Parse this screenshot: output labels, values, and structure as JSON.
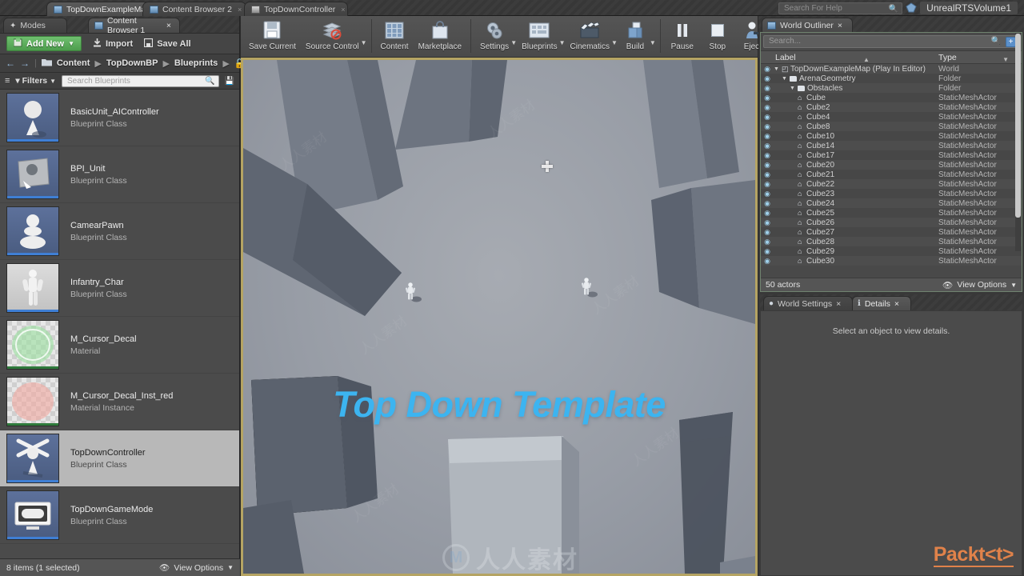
{
  "app": {
    "top_tabs": [
      {
        "label": "TopDownExampleMap",
        "icon": "map-icon",
        "active": true,
        "closable": true
      },
      {
        "label": "Content Browser 2",
        "icon": "content-browser-icon",
        "active": false,
        "closable": true
      },
      {
        "label": "TopDownController",
        "icon": "blueprint-icon",
        "active": false,
        "closable": true
      }
    ],
    "search_help_placeholder": "Search For Help",
    "volume_label": "UnrealRTSVolume1"
  },
  "left_panel": {
    "sub_tabs": [
      {
        "label": "Modes",
        "icon": "modes-icon",
        "active": false
      },
      {
        "label": "Content Browser 1",
        "icon": "content-browser-icon",
        "active": true
      }
    ],
    "toolbar": {
      "add_new": "Add New",
      "import": "Import",
      "save_all": "Save All"
    },
    "breadcrumb": [
      "Content",
      "TopDownBP",
      "Blueprints"
    ],
    "filters_label": "Filters",
    "search_placeholder": "Search Blueprints",
    "assets": [
      {
        "name": "BasicUnit_AIController",
        "type": "Blueprint Class",
        "thumb": "blueprint",
        "selected": false
      },
      {
        "name": "BPI_Unit",
        "type": "Blueprint Class",
        "thumb": "blueprint-interface",
        "selected": false
      },
      {
        "name": "CamearPawn",
        "type": "Blueprint Class",
        "thumb": "pawn",
        "selected": false
      },
      {
        "name": "Infantry_Char",
        "type": "Blueprint Class",
        "thumb": "character",
        "selected": false
      },
      {
        "name": "M_Cursor_Decal",
        "type": "Material",
        "thumb": "material-green",
        "selected": false
      },
      {
        "name": "M_Cursor_Decal_Inst_red",
        "type": "Material Instance",
        "thumb": "material-red",
        "selected": false
      },
      {
        "name": "TopDownController",
        "type": "Blueprint Class",
        "thumb": "controller",
        "selected": true
      },
      {
        "name": "TopDownGameMode",
        "type": "Blueprint Class",
        "thumb": "gamemode",
        "selected": false
      }
    ],
    "status": "8 items (1 selected)",
    "view_options": "View Options"
  },
  "main_toolbar": {
    "groups": [
      [
        {
          "label": "Save Current",
          "icon": "save-icon",
          "dropdown": false
        },
        {
          "label": "Source Control",
          "icon": "source-control-icon",
          "dropdown": true
        }
      ],
      [
        {
          "label": "Content",
          "icon": "content-icon",
          "dropdown": false
        },
        {
          "label": "Marketplace",
          "icon": "marketplace-icon",
          "dropdown": false
        }
      ],
      [
        {
          "label": "Settings",
          "icon": "settings-icon",
          "dropdown": true
        },
        {
          "label": "Blueprints",
          "icon": "blueprints-icon",
          "dropdown": true
        },
        {
          "label": "Cinematics",
          "icon": "cinematics-icon",
          "dropdown": true
        },
        {
          "label": "Build",
          "icon": "build-icon",
          "dropdown": true
        }
      ],
      [
        {
          "label": "Pause",
          "icon": "pause-icon",
          "dropdown": false
        },
        {
          "label": "Stop",
          "icon": "stop-icon",
          "dropdown": false
        },
        {
          "label": "Eject",
          "icon": "eject-icon",
          "dropdown": false
        }
      ]
    ]
  },
  "viewport": {
    "title_text": "Top Down Template",
    "title_color": "#3cb4f0",
    "border_color": "#b5a463",
    "cursor": "crosshair-cursor"
  },
  "world_outliner": {
    "tab_label": "World Outliner",
    "search_placeholder": "Search...",
    "columns": {
      "label": "Label",
      "type": "Type"
    },
    "rows": [
      {
        "label": "TopDownExampleMap (Play In Editor)",
        "type": "World",
        "depth": 0,
        "icon": "world-icon",
        "expandable": true
      },
      {
        "label": "ArenaGeometry",
        "type": "Folder",
        "depth": 1,
        "icon": "folder-icon",
        "expandable": true
      },
      {
        "label": "Obstacles",
        "type": "Folder",
        "depth": 2,
        "icon": "folder-icon",
        "expandable": true
      },
      {
        "label": "Cube",
        "type": "StaticMeshActor",
        "depth": 3,
        "icon": "mesh-icon",
        "expandable": false
      },
      {
        "label": "Cube2",
        "type": "StaticMeshActor",
        "depth": 3,
        "icon": "mesh-icon",
        "expandable": false
      },
      {
        "label": "Cube4",
        "type": "StaticMeshActor",
        "depth": 3,
        "icon": "mesh-icon",
        "expandable": false
      },
      {
        "label": "Cube8",
        "type": "StaticMeshActor",
        "depth": 3,
        "icon": "mesh-icon",
        "expandable": false
      },
      {
        "label": "Cube10",
        "type": "StaticMeshActor",
        "depth": 3,
        "icon": "mesh-icon",
        "expandable": false
      },
      {
        "label": "Cube14",
        "type": "StaticMeshActor",
        "depth": 3,
        "icon": "mesh-icon",
        "expandable": false
      },
      {
        "label": "Cube17",
        "type": "StaticMeshActor",
        "depth": 3,
        "icon": "mesh-icon",
        "expandable": false
      },
      {
        "label": "Cube20",
        "type": "StaticMeshActor",
        "depth": 3,
        "icon": "mesh-icon",
        "expandable": false
      },
      {
        "label": "Cube21",
        "type": "StaticMeshActor",
        "depth": 3,
        "icon": "mesh-icon",
        "expandable": false
      },
      {
        "label": "Cube22",
        "type": "StaticMeshActor",
        "depth": 3,
        "icon": "mesh-icon",
        "expandable": false
      },
      {
        "label": "Cube23",
        "type": "StaticMeshActor",
        "depth": 3,
        "icon": "mesh-icon",
        "expandable": false
      },
      {
        "label": "Cube24",
        "type": "StaticMeshActor",
        "depth": 3,
        "icon": "mesh-icon",
        "expandable": false
      },
      {
        "label": "Cube25",
        "type": "StaticMeshActor",
        "depth": 3,
        "icon": "mesh-icon",
        "expandable": false
      },
      {
        "label": "Cube26",
        "type": "StaticMeshActor",
        "depth": 3,
        "icon": "mesh-icon",
        "expandable": false
      },
      {
        "label": "Cube27",
        "type": "StaticMeshActor",
        "depth": 3,
        "icon": "mesh-icon",
        "expandable": false
      },
      {
        "label": "Cube28",
        "type": "StaticMeshActor",
        "depth": 3,
        "icon": "mesh-icon",
        "expandable": false
      },
      {
        "label": "Cube29",
        "type": "StaticMeshActor",
        "depth": 3,
        "icon": "mesh-icon",
        "expandable": false
      },
      {
        "label": "Cube30",
        "type": "StaticMeshActor",
        "depth": 3,
        "icon": "mesh-icon",
        "expandable": false
      }
    ],
    "actor_count": "50 actors",
    "view_options": "View Options"
  },
  "details_panel": {
    "tabs": [
      {
        "label": "World Settings",
        "icon": "world-settings-icon",
        "active": false
      },
      {
        "label": "Details",
        "icon": "details-icon",
        "active": true
      }
    ],
    "empty_message": "Select an object to view details."
  },
  "watermarks": {
    "cn_logo_text": "人人素材",
    "cn_logo_mark": "M",
    "publisher": "Packt"
  }
}
